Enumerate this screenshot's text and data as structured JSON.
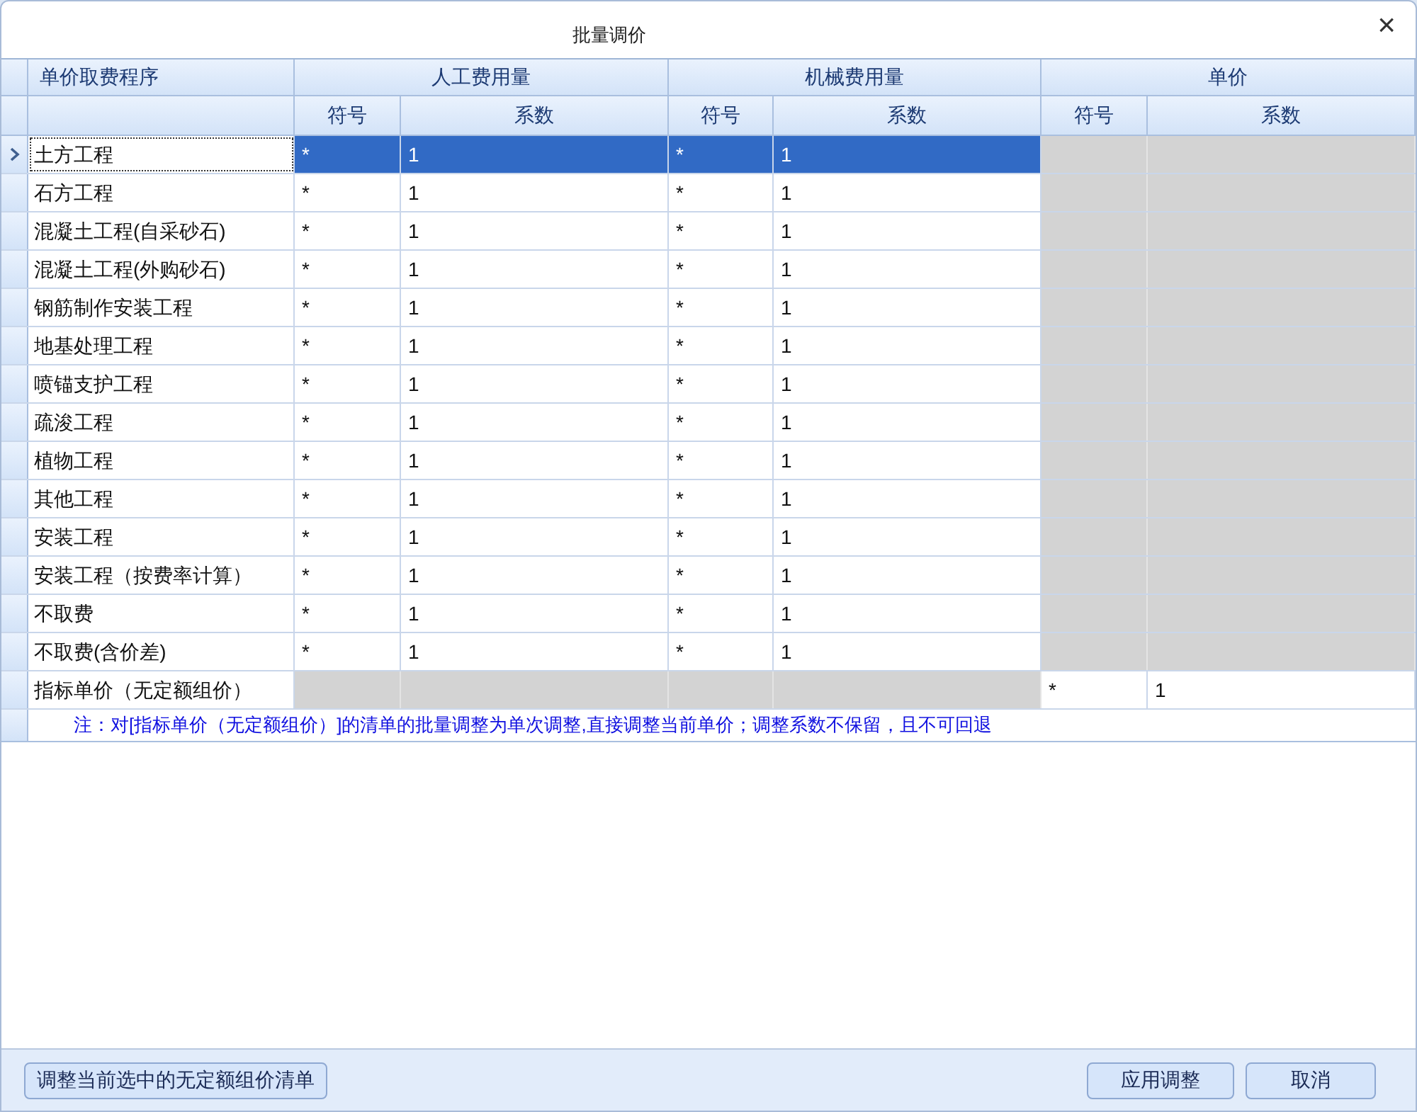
{
  "window": {
    "title": "批量调价",
    "close": "×"
  },
  "table": {
    "group_headers": [
      "单价取费程序",
      "人工费用量",
      "机械费用量",
      "单价"
    ],
    "sub_headers": [
      "符号",
      "系数",
      "符号",
      "系数",
      "符号",
      "系数"
    ],
    "rows": [
      {
        "kind": "fee",
        "selected": true,
        "name": "土方工程",
        "labor_symbol": "*",
        "labor_coef": "1",
        "machine_symbol": "*",
        "machine_coef": "1"
      },
      {
        "kind": "fee",
        "selected": false,
        "name": "石方工程",
        "labor_symbol": "*",
        "labor_coef": "1",
        "machine_symbol": "*",
        "machine_coef": "1"
      },
      {
        "kind": "fee",
        "selected": false,
        "name": "混凝土工程(自采砂石)",
        "labor_symbol": "*",
        "labor_coef": "1",
        "machine_symbol": "*",
        "machine_coef": "1"
      },
      {
        "kind": "fee",
        "selected": false,
        "name": "混凝土工程(外购砂石)",
        "labor_symbol": "*",
        "labor_coef": "1",
        "machine_symbol": "*",
        "machine_coef": "1"
      },
      {
        "kind": "fee",
        "selected": false,
        "name": "钢筋制作安装工程",
        "labor_symbol": "*",
        "labor_coef": "1",
        "machine_symbol": "*",
        "machine_coef": "1"
      },
      {
        "kind": "fee",
        "selected": false,
        "name": "地基处理工程",
        "labor_symbol": "*",
        "labor_coef": "1",
        "machine_symbol": "*",
        "machine_coef": "1"
      },
      {
        "kind": "fee",
        "selected": false,
        "name": "喷锚支护工程",
        "labor_symbol": "*",
        "labor_coef": "1",
        "machine_symbol": "*",
        "machine_coef": "1"
      },
      {
        "kind": "fee",
        "selected": false,
        "name": "疏浚工程",
        "labor_symbol": "*",
        "labor_coef": "1",
        "machine_symbol": "*",
        "machine_coef": "1"
      },
      {
        "kind": "fee",
        "selected": false,
        "name": "植物工程",
        "labor_symbol": "*",
        "labor_coef": "1",
        "machine_symbol": "*",
        "machine_coef": "1"
      },
      {
        "kind": "fee",
        "selected": false,
        "name": "其他工程",
        "labor_symbol": "*",
        "labor_coef": "1",
        "machine_symbol": "*",
        "machine_coef": "1"
      },
      {
        "kind": "fee",
        "selected": false,
        "name": "安装工程",
        "labor_symbol": "*",
        "labor_coef": "1",
        "machine_symbol": "*",
        "machine_coef": "1"
      },
      {
        "kind": "fee",
        "selected": false,
        "name": "安装工程（按费率计算）",
        "labor_symbol": "*",
        "labor_coef": "1",
        "machine_symbol": "*",
        "machine_coef": "1"
      },
      {
        "kind": "fee",
        "selected": false,
        "name": "不取费",
        "labor_symbol": "*",
        "labor_coef": "1",
        "machine_symbol": "*",
        "machine_coef": "1"
      },
      {
        "kind": "fee",
        "selected": false,
        "name": "不取费(含价差)",
        "labor_symbol": "*",
        "labor_coef": "1",
        "machine_symbol": "*",
        "machine_coef": "1"
      },
      {
        "kind": "index",
        "selected": false,
        "name": "指标单价（无定额组价）",
        "price_symbol": "*",
        "price_coef": "1"
      }
    ],
    "note": "注：对[指标单价（无定额组价）]的清单的批量调整为单次调整,直接调整当前单价；调整系数不保留，且不可回退"
  },
  "buttons": {
    "left": "调整当前选中的无定额组价清单",
    "apply": "应用调整",
    "cancel": "取消"
  }
}
